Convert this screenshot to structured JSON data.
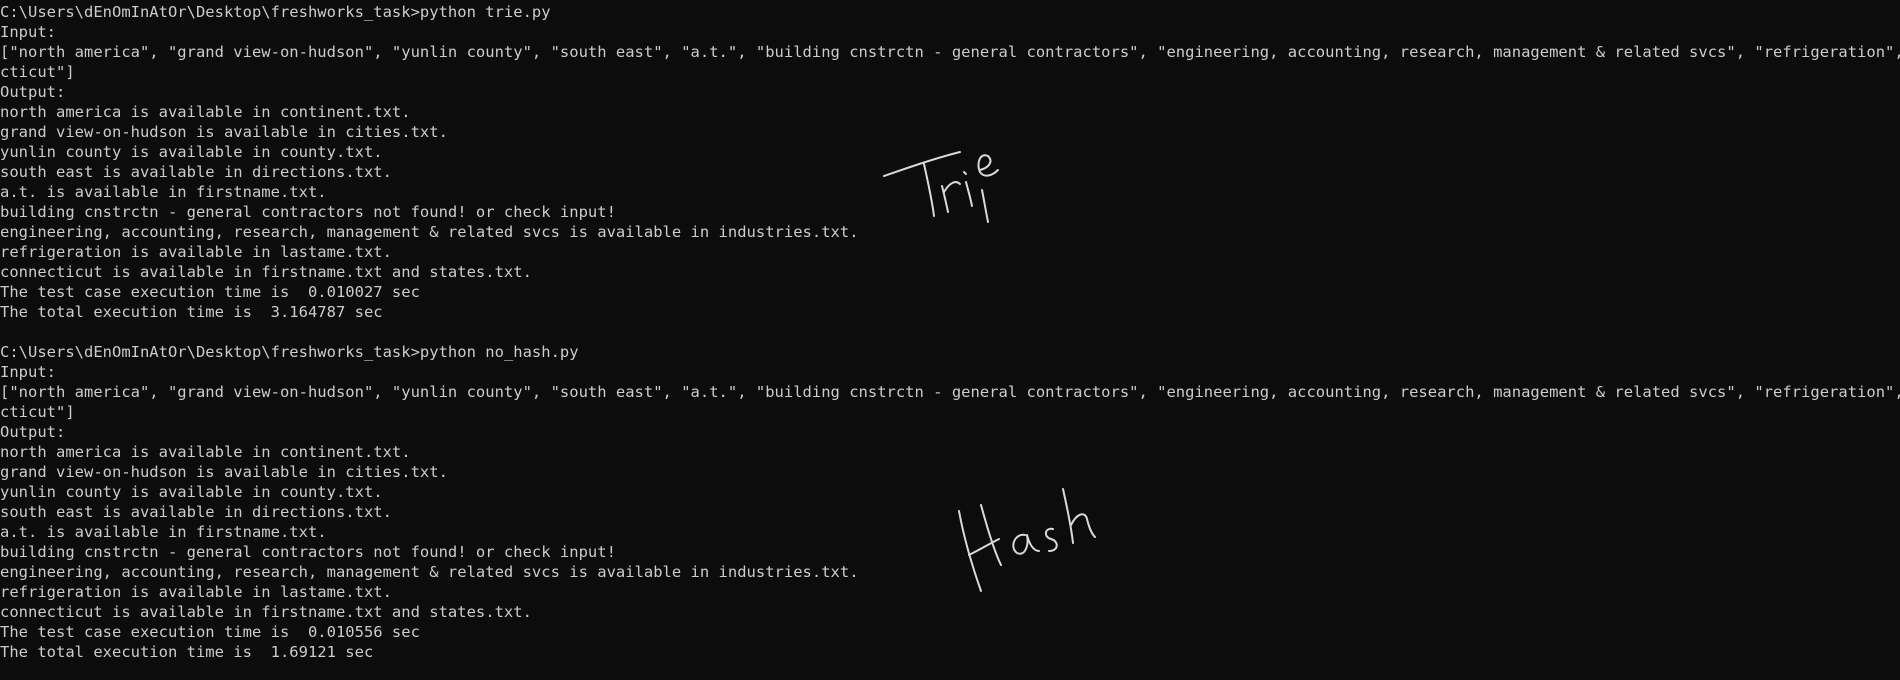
{
  "run1": {
    "prompt": "C:\\Users\\dEnOmInAtOr\\Desktop\\freshworks_task>python trie.py",
    "input_label": "Input:",
    "input_line1": "[\"north america\", \"grand view-on-hudson\", \"yunlin county\", \"south east\", \"a.t.\", \"building cnstrctn - general contractors\", \"engineering, accounting, research, management & related svcs\", \"refrigeration\", \"conne",
    "input_line2": "cticut\"]",
    "output_label": "Output:",
    "results": [
      "north america is available in continent.txt.",
      "grand view-on-hudson is available in cities.txt.",
      "yunlin county is available in county.txt.",
      "south east is available in directions.txt.",
      "a.t. is available in firstname.txt.",
      "building cnstrctn - general contractors not found! or check input!",
      "engineering, accounting, research, management & related svcs is available in industries.txt.",
      "refrigeration is available in lastame.txt.",
      "connecticut is available in firstname.txt and states.txt."
    ],
    "test_time": "The test case execution time is  0.010027 sec",
    "total_time": "The total execution time is  3.164787 sec",
    "annotation": "Trie"
  },
  "run2": {
    "prompt": "C:\\Users\\dEnOmInAtOr\\Desktop\\freshworks_task>python no_hash.py",
    "input_label": "Input:",
    "input_line1": "[\"north america\", \"grand view-on-hudson\", \"yunlin county\", \"south east\", \"a.t.\", \"building cnstrctn - general contractors\", \"engineering, accounting, research, management & related svcs\", \"refrigeration\", \"conne",
    "input_line2": "cticut\"]",
    "output_label": "Output:",
    "results": [
      "north america is available in continent.txt.",
      "grand view-on-hudson is available in cities.txt.",
      "yunlin county is available in county.txt.",
      "south east is available in directions.txt.",
      "a.t. is available in firstname.txt.",
      "building cnstrctn - general contractors not found! or check input!",
      "engineering, accounting, research, management & related svcs is available in industries.txt.",
      "refrigeration is available in lastame.txt.",
      "connecticut is available in firstname.txt and states.txt."
    ],
    "test_time": "The test case execution time is  0.010556 sec",
    "total_time": "The total execution time is  1.69121 sec",
    "annotation": "Hash"
  },
  "colors": {
    "background": "#0c0c0c",
    "text": "#cccccc",
    "ink": "#d9d9d9"
  }
}
